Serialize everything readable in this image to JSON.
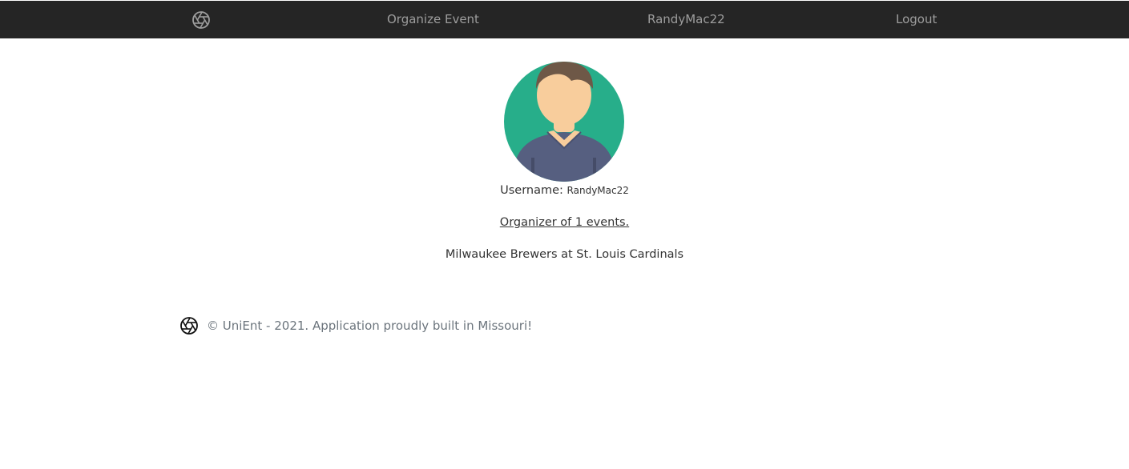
{
  "nav": {
    "logo_icon": "aperture-icon",
    "organize_label": "Organize Event",
    "user_label": "RandyMac22",
    "logout_label": "Logout"
  },
  "profile": {
    "avatar_icon": "user-avatar-icon",
    "username_label": "Username:",
    "username_value": "RandyMac22",
    "organizer_text": "Organizer of 1 events.",
    "events": [
      "Milwaukee Brewers at St. Louis Cardinals"
    ]
  },
  "footer": {
    "logo_icon": "aperture-icon",
    "text": "© UniEnt - 2021. Application proudly built in Missouri!"
  },
  "colors": {
    "navbar_bg": "#252525",
    "nav_text": "#9d9d9d",
    "avatar_bg": "#27ae8a",
    "body_text": "#333333",
    "footer_text": "#6c757d"
  }
}
